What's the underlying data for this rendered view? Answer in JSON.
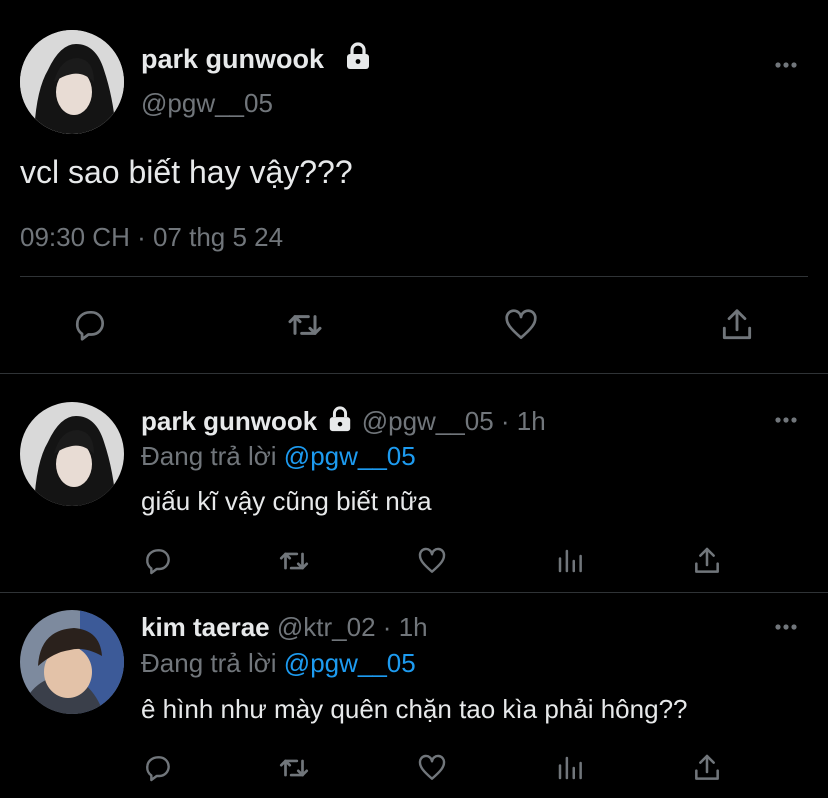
{
  "main_tweet": {
    "name": "park gunwook",
    "handle": "@pgw__05",
    "text": "vcl sao biết hay vậy???",
    "timestamp": "09:30 CH · 07 thg 5 24"
  },
  "replies": [
    {
      "name": "park gunwook",
      "handle": "@pgw__05",
      "dot": "·",
      "time": "1h",
      "replying_label": "Đang trả lời",
      "replying_to": "@pgw__05",
      "text": "giấu kĩ vậy cũng biết nữa"
    },
    {
      "name": "kim taerae",
      "handle": "@ktr_02",
      "dot": "·",
      "time": "1h",
      "replying_label": "Đang trả lời",
      "replying_to": "@pgw__05",
      "text": "ê hình như mày quên chặn tao kìa phải hông??"
    }
  ],
  "icons": [
    "lock-icon",
    "more-icon",
    "reply-icon",
    "retweet-icon",
    "like-icon",
    "share-icon",
    "views-icon"
  ],
  "colors": {
    "background": "#000000",
    "text": "#e7e9ea",
    "muted": "#71767b",
    "link": "#1d9bf0",
    "divider": "#2f3336"
  }
}
